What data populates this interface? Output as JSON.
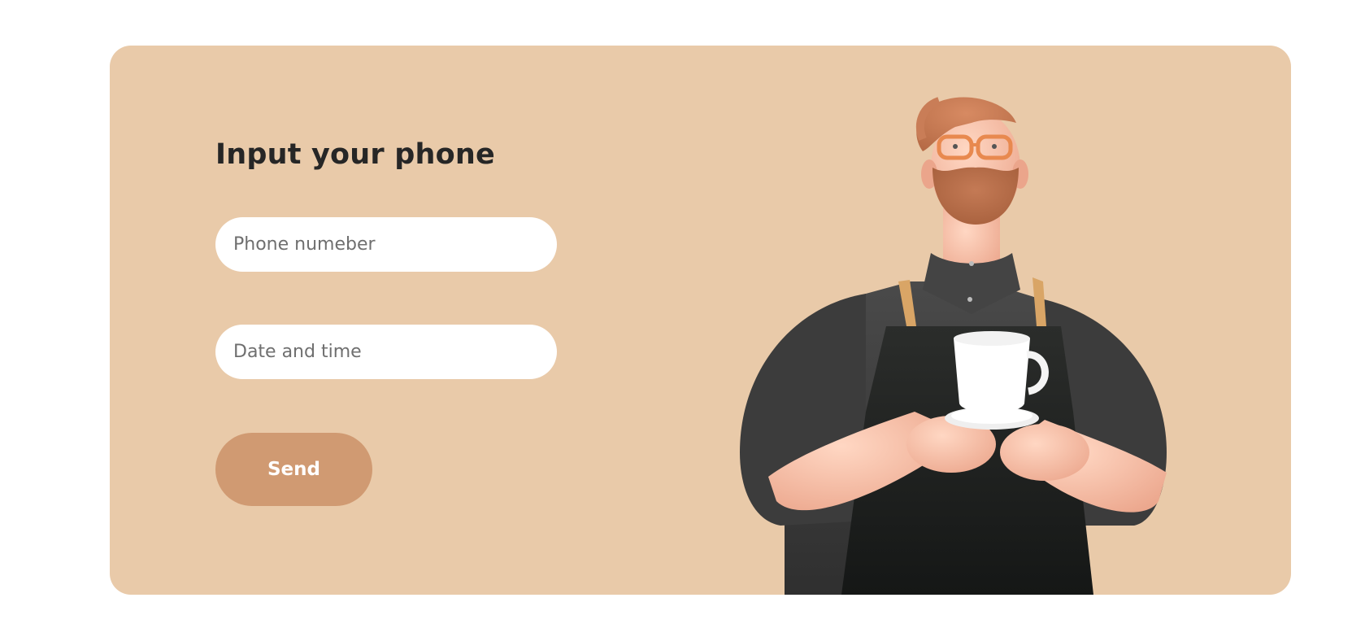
{
  "form": {
    "title": "Input your phone",
    "phone_placeholder": "Phone numeber",
    "date_placeholder": "Date and time",
    "send_label": "Send"
  },
  "illustration": {
    "subject": "barista-character-holding-cup",
    "icon": "barista-illustration"
  },
  "colors": {
    "card_background": "#e9caa9",
    "button_background": "#d09a72",
    "input_background": "#ffffff",
    "title_text": "#262626"
  }
}
